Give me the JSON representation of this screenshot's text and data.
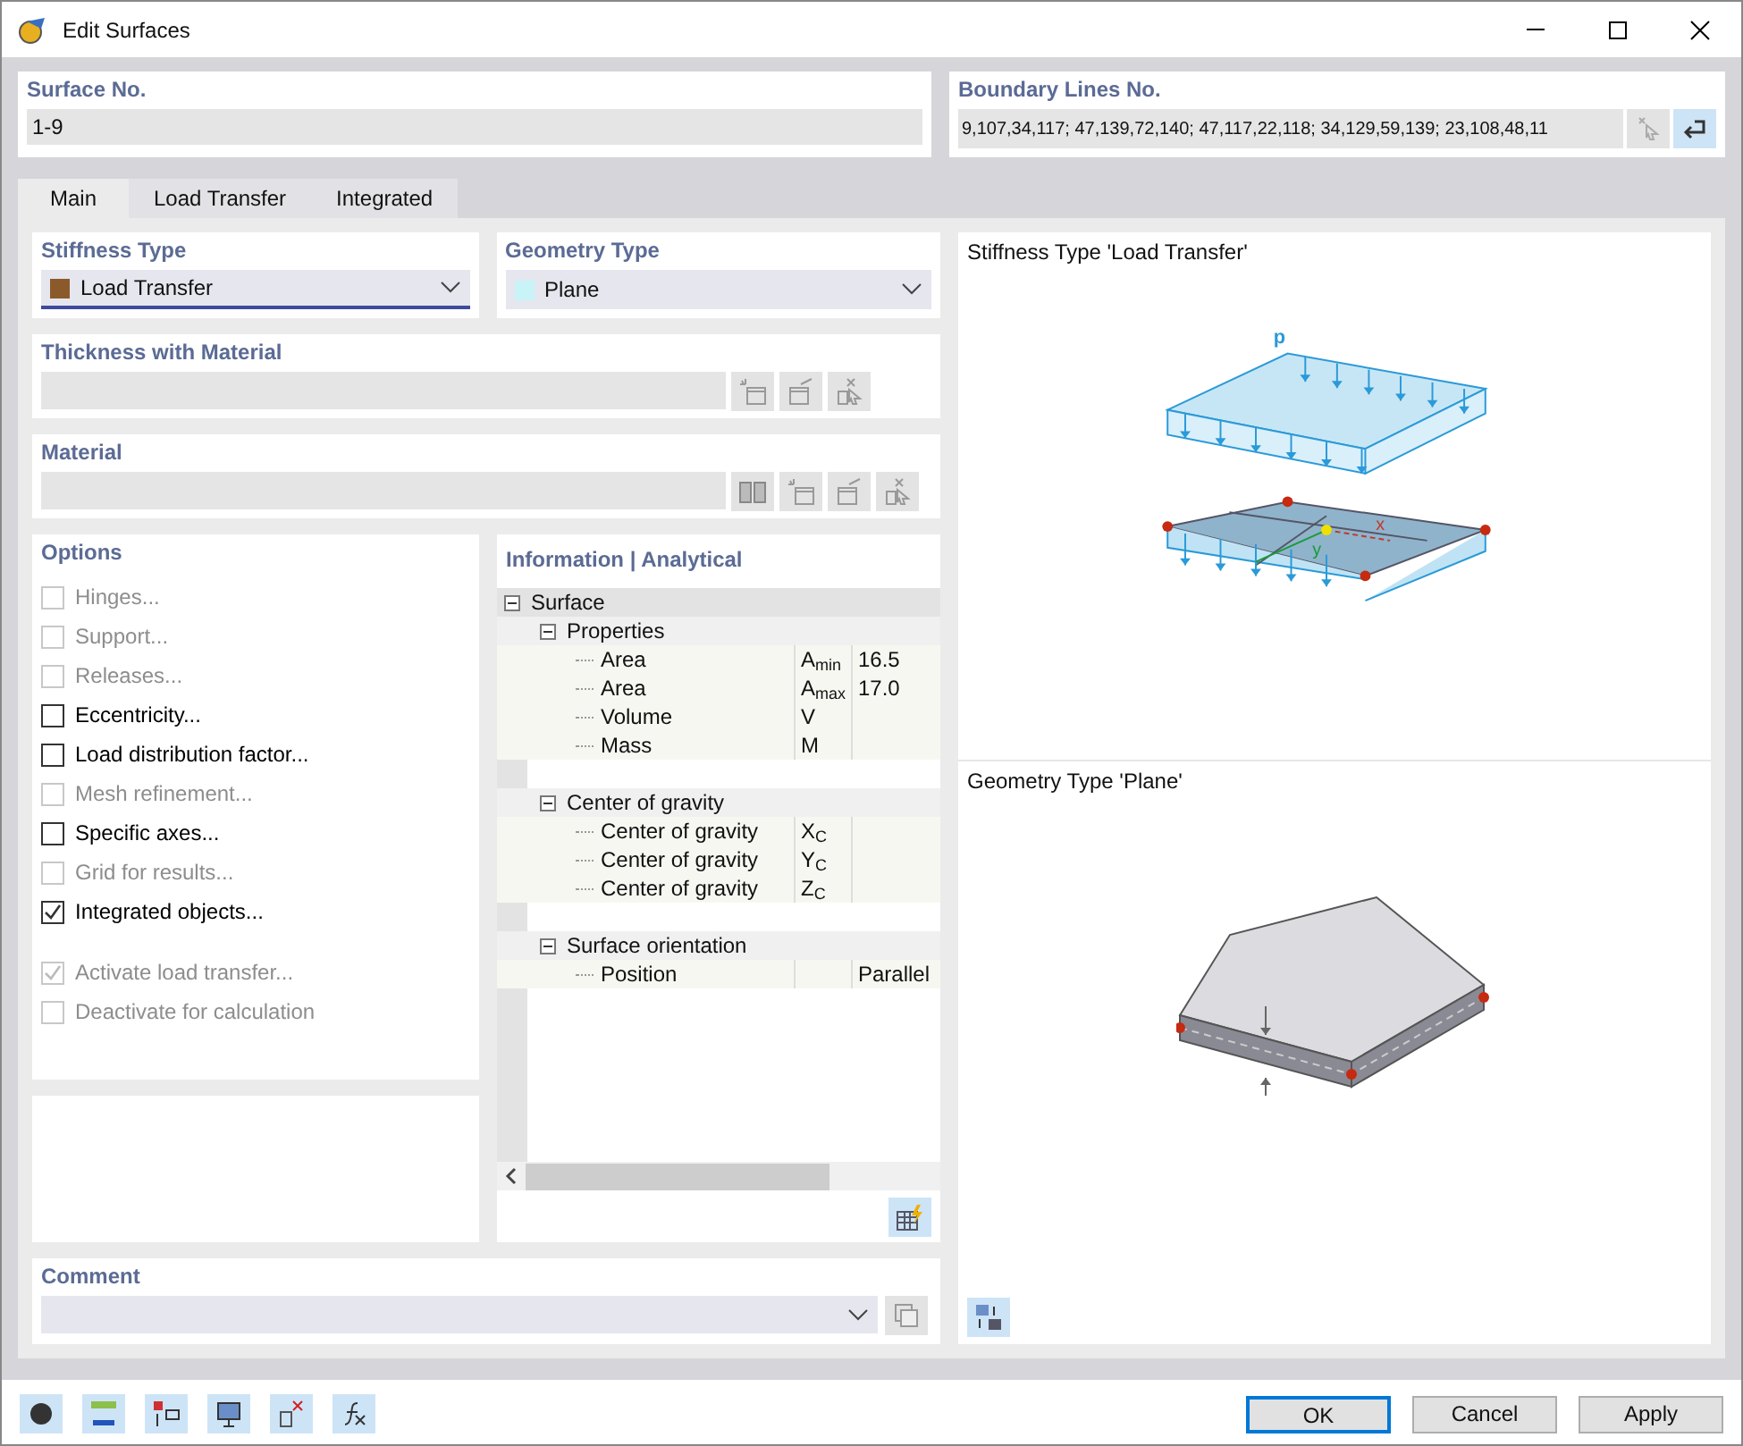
{
  "window": {
    "title": "Edit Surfaces"
  },
  "surface_no": {
    "label": "Surface No.",
    "value": "1-9"
  },
  "boundary_lines": {
    "label": "Boundary Lines No.",
    "value": "9,107,34,117; 47,139,72,140; 47,117,22,118; 34,129,59,139; 23,108,48,11"
  },
  "tabs": [
    {
      "label": "Main",
      "selected": true
    },
    {
      "label": "Load Transfer",
      "selected": false
    },
    {
      "label": "Integrated",
      "selected": false
    }
  ],
  "stiffness_type": {
    "label": "Stiffness Type",
    "value": "Load Transfer",
    "color": "#8b5a2b"
  },
  "geometry_type": {
    "label": "Geometry Type",
    "value": "Plane",
    "color": "#c8f4f8"
  },
  "thickness": {
    "label": "Thickness with Material"
  },
  "material": {
    "label": "Material"
  },
  "options": {
    "label": "Options",
    "items": [
      {
        "label": "Hinges...",
        "checked": false,
        "disabled": true
      },
      {
        "label": "Support...",
        "checked": false,
        "disabled": true
      },
      {
        "label": "Releases...",
        "checked": false,
        "disabled": true
      },
      {
        "label": "Eccentricity...",
        "checked": false,
        "disabled": false
      },
      {
        "label": "Load distribution factor...",
        "checked": false,
        "disabled": false
      },
      {
        "label": "Mesh refinement...",
        "checked": false,
        "disabled": true
      },
      {
        "label": "Specific axes...",
        "checked": false,
        "disabled": false
      },
      {
        "label": "Grid for results...",
        "checked": false,
        "disabled": true
      },
      {
        "label": "Integrated objects...",
        "checked": true,
        "disabled": false
      }
    ],
    "extra_items": [
      {
        "label": "Activate load transfer...",
        "checked": true,
        "disabled": true
      },
      {
        "label": "Deactivate for calculation",
        "checked": false,
        "disabled": true
      }
    ]
  },
  "information": {
    "label": "Information | Analytical",
    "tree": [
      {
        "label": "Surface",
        "expanded": true,
        "children": [
          {
            "label": "Properties",
            "expanded": true,
            "children": [
              {
                "label": "Area",
                "symbol": "A$_{min}$",
                "value": "16.5"
              },
              {
                "label": "Area",
                "symbol": "A$_{max}$",
                "value": "17.0"
              },
              {
                "label": "Volume",
                "symbol": "V"
              },
              {
                "label": "Mass",
                "symbol": "M"
              }
            ]
          },
          {
            "label": "Center of gravity",
            "expanded": true,
            "children": [
              {
                "label": "Center of gravity",
                "symbol": "X$_{C}$"
              },
              {
                "label": "Center of gravity",
                "symbol": "Y$_{C}$"
              },
              {
                "label": "Center of gravity",
                "symbol": "Z$_{C}$"
              }
            ]
          },
          {
            "label": "Surface orientation",
            "expanded": true,
            "children": [
              {
                "label": "Position",
                "value": "Parallel"
              }
            ]
          }
        ]
      }
    ]
  },
  "comment": {
    "label": "Comment"
  },
  "stiffness_preview": {
    "title": "Stiffness Type 'Load Transfer'",
    "labels": [
      "p",
      "x",
      "y"
    ]
  },
  "geometry_preview": {
    "title": "Geometry Type 'Plane'"
  },
  "buttons": [
    {
      "label": "OK",
      "default": true
    },
    {
      "label": "Cancel",
      "default": false
    },
    {
      "label": "Apply",
      "default": false
    }
  ]
}
